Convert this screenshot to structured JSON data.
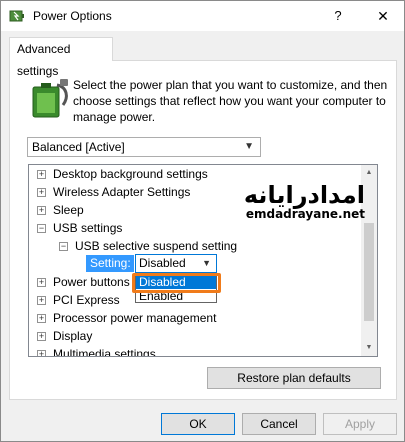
{
  "window": {
    "title": "Power Options",
    "help_icon": "?",
    "close_icon": "✕"
  },
  "tab": {
    "label": "Advanced settings"
  },
  "description": "Select the power plan that you want to customize, and then choose settings that reflect how you want your computer to manage power.",
  "plan_select": {
    "value": "Balanced [Active]"
  },
  "tree": {
    "items": [
      {
        "label": "Desktop background settings",
        "expander": "+"
      },
      {
        "label": "Wireless Adapter Settings",
        "expander": "+"
      },
      {
        "label": "Sleep",
        "expander": "+"
      },
      {
        "label": "USB settings",
        "expander": "−"
      },
      {
        "label": "USB selective suspend setting",
        "expander": "−"
      },
      {
        "label": "Power buttons",
        "expander": "+"
      },
      {
        "label": "PCI Express",
        "expander": "+"
      },
      {
        "label": "Processor power management",
        "expander": "+"
      },
      {
        "label": "Display",
        "expander": "+"
      },
      {
        "label": "Multimedia settings",
        "expander": "+"
      }
    ]
  },
  "setting": {
    "label": "Setting:",
    "value": "Disabled",
    "options": [
      "Disabled",
      "Enabled"
    ]
  },
  "watermark": {
    "persian": "امدادرایانه",
    "url": "emdadrayane.net"
  },
  "buttons": {
    "restore": "Restore plan defaults",
    "ok": "OK",
    "cancel": "Cancel",
    "apply": "Apply"
  },
  "colors": {
    "accent": "#0078d7",
    "selection": "#3399ff",
    "highlight_box": "#f07b1a"
  }
}
